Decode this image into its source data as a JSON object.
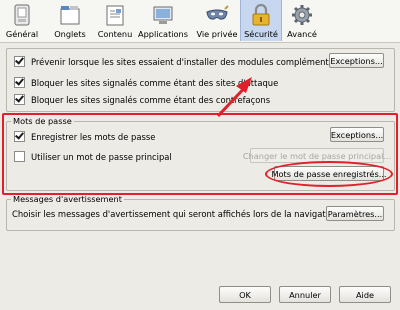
{
  "tabs": [
    {
      "label": "Général",
      "icon": "switch-icon"
    },
    {
      "label": "Onglets",
      "icon": "tabs-icon"
    },
    {
      "label": "Contenu",
      "icon": "document-icon"
    },
    {
      "label": "Applications",
      "icon": "applications-icon"
    },
    {
      "label": "Vie privée",
      "icon": "mask-icon"
    },
    {
      "label": "Sécurité",
      "icon": "padlock-icon",
      "active": true
    },
    {
      "label": "Avancé",
      "icon": "gear-icon"
    }
  ],
  "security": {
    "warn_addons": "Prévenir lorsque les sites essaient d'installer des modules complémentaires",
    "block_attack": "Bloquer les sites signalés comme étant des sites d'attaque",
    "block_forgery": "Bloquer les sites signalés comme étant des contrefaçons",
    "exceptions_label": "Exceptions..."
  },
  "passwords": {
    "group_title": "Mots de passe",
    "remember": "Enregistrer les mots de passe",
    "exceptions_label": "Exceptions...",
    "use_master": "Utiliser un mot de passe principal",
    "change_master": "Changer le mot de passe principal...",
    "saved_passwords": "Mots de passe enregistrés..."
  },
  "warnings": {
    "group_title": "Messages d'avertissement",
    "description": "Choisir les messages d'avertissement qui seront affichés lors de la navigation",
    "settings_label": "Paramètres..."
  },
  "footer": {
    "ok": "OK",
    "cancel": "Annuler",
    "help": "Aide"
  },
  "colors": {
    "annotation": "#e0202a",
    "active_tab": "#c6d7ef"
  }
}
